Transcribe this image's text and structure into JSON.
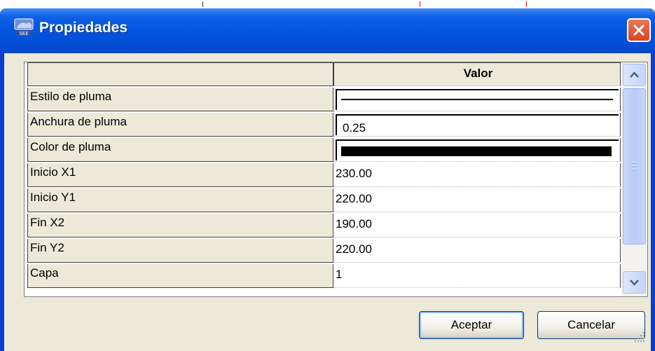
{
  "window": {
    "title": "Propiedades",
    "app_icon": "window-icon",
    "close_icon": "close-icon"
  },
  "grid": {
    "header": {
      "name": "",
      "value": "Valor"
    },
    "rows": [
      {
        "name": "Estilo de pluma",
        "value": "",
        "value_type": "line-style-swatch"
      },
      {
        "name": "Anchura de pluma",
        "value": "0.25",
        "value_type": "text-edit"
      },
      {
        "name": "Color de pluma",
        "value": "",
        "value_type": "color-swatch",
        "color": "#000000"
      },
      {
        "name": "Inicio X1",
        "value": "230.00"
      },
      {
        "name": "Inicio Y1",
        "value": "220.00"
      },
      {
        "name": "Fin X2",
        "value": "190.00"
      },
      {
        "name": "Fin Y2",
        "value": "220.00"
      },
      {
        "name": "Capa",
        "value": "1"
      }
    ]
  },
  "buttons": {
    "ok": "Aceptar",
    "cancel": "Cancelar"
  },
  "colors": {
    "titlebar": "#0455e0",
    "close_button": "#d9451f",
    "dialog_bg": "#ece9d8",
    "scrollbar": "#c5d5f7"
  }
}
